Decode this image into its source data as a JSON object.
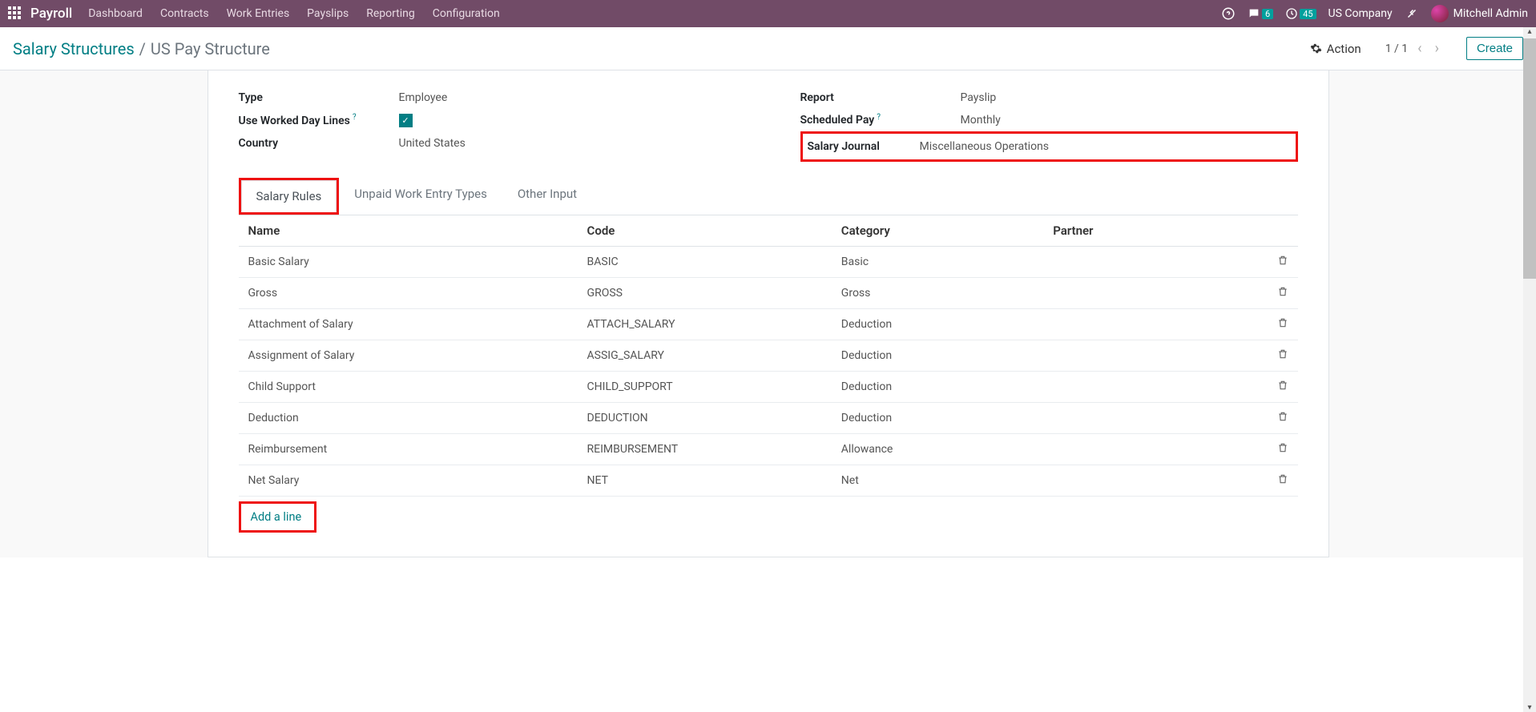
{
  "nav": {
    "brand": "Payroll",
    "menu": [
      "Dashboard",
      "Contracts",
      "Work Entries",
      "Payslips",
      "Reporting",
      "Configuration"
    ],
    "messages_badge": "6",
    "activities_badge": "45",
    "company": "US Company",
    "user": "Mitchell Admin"
  },
  "breadcrumb": {
    "root": "Salary Structures",
    "current": "US Pay Structure"
  },
  "actions": {
    "action_label": "Action",
    "pager": "1 / 1",
    "create_label": "Create"
  },
  "fields_left": {
    "type_label": "Type",
    "type_value": "Employee",
    "worked_days_label": "Use Worked Day Lines",
    "worked_days_value": true,
    "country_label": "Country",
    "country_value": "United States"
  },
  "fields_right": {
    "report_label": "Report",
    "report_value": "Payslip",
    "sched_label": "Scheduled Pay",
    "sched_value": "Monthly",
    "journal_label": "Salary Journal",
    "journal_value": "Miscellaneous Operations"
  },
  "tabs": [
    "Salary Rules",
    "Unpaid Work Entry Types",
    "Other Input"
  ],
  "table": {
    "headers": {
      "name": "Name",
      "code": "Code",
      "category": "Category",
      "partner": "Partner"
    },
    "rows": [
      {
        "name": "Basic Salary",
        "code": "BASIC",
        "category": "Basic",
        "partner": ""
      },
      {
        "name": "Gross",
        "code": "GROSS",
        "category": "Gross",
        "partner": ""
      },
      {
        "name": "Attachment of Salary",
        "code": "ATTACH_SALARY",
        "category": "Deduction",
        "partner": ""
      },
      {
        "name": "Assignment of Salary",
        "code": "ASSIG_SALARY",
        "category": "Deduction",
        "partner": ""
      },
      {
        "name": "Child Support",
        "code": "CHILD_SUPPORT",
        "category": "Deduction",
        "partner": ""
      },
      {
        "name": "Deduction",
        "code": "DEDUCTION",
        "category": "Deduction",
        "partner": ""
      },
      {
        "name": "Reimbursement",
        "code": "REIMBURSEMENT",
        "category": "Allowance",
        "partner": ""
      },
      {
        "name": "Net Salary",
        "code": "NET",
        "category": "Net",
        "partner": ""
      }
    ],
    "add_line": "Add a line"
  }
}
